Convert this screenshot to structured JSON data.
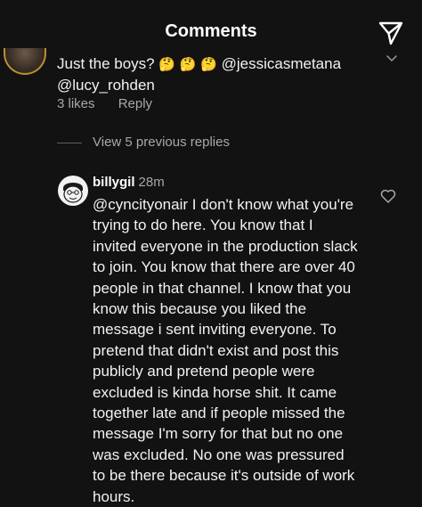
{
  "header": {
    "title": "Comments",
    "send_icon": "paper-plane-icon"
  },
  "comment": {
    "text_prefix": "Just the boys? ",
    "emojis": [
      "🤔",
      "🤔",
      "🤔"
    ],
    "mention_1": "@jessicasmetana",
    "mention_2": "@lucy_rohden",
    "likes": "3 likes",
    "reply_label": "Reply"
  },
  "view_replies": "View 5 previous replies",
  "reply": {
    "username": "billygil",
    "time": "28m",
    "text": "@cyncityonair I don't know what you're trying to do here. You know that I invited everyone in the production slack to join. You know that there are over 40 people in that channel. I know that you know this because you liked the message i sent inviting everyone. To pretend that didn't exist and post this publicly and pretend people were excluded is kinda horse shit. It came together late and if people missed the message I'm sorry for that but no one was excluded. No one was pressured to be there because it's outside of work hours."
  },
  "colors": {
    "background": "#121212",
    "text": "#f2f2f2",
    "secondary": "#a8a8a8"
  }
}
